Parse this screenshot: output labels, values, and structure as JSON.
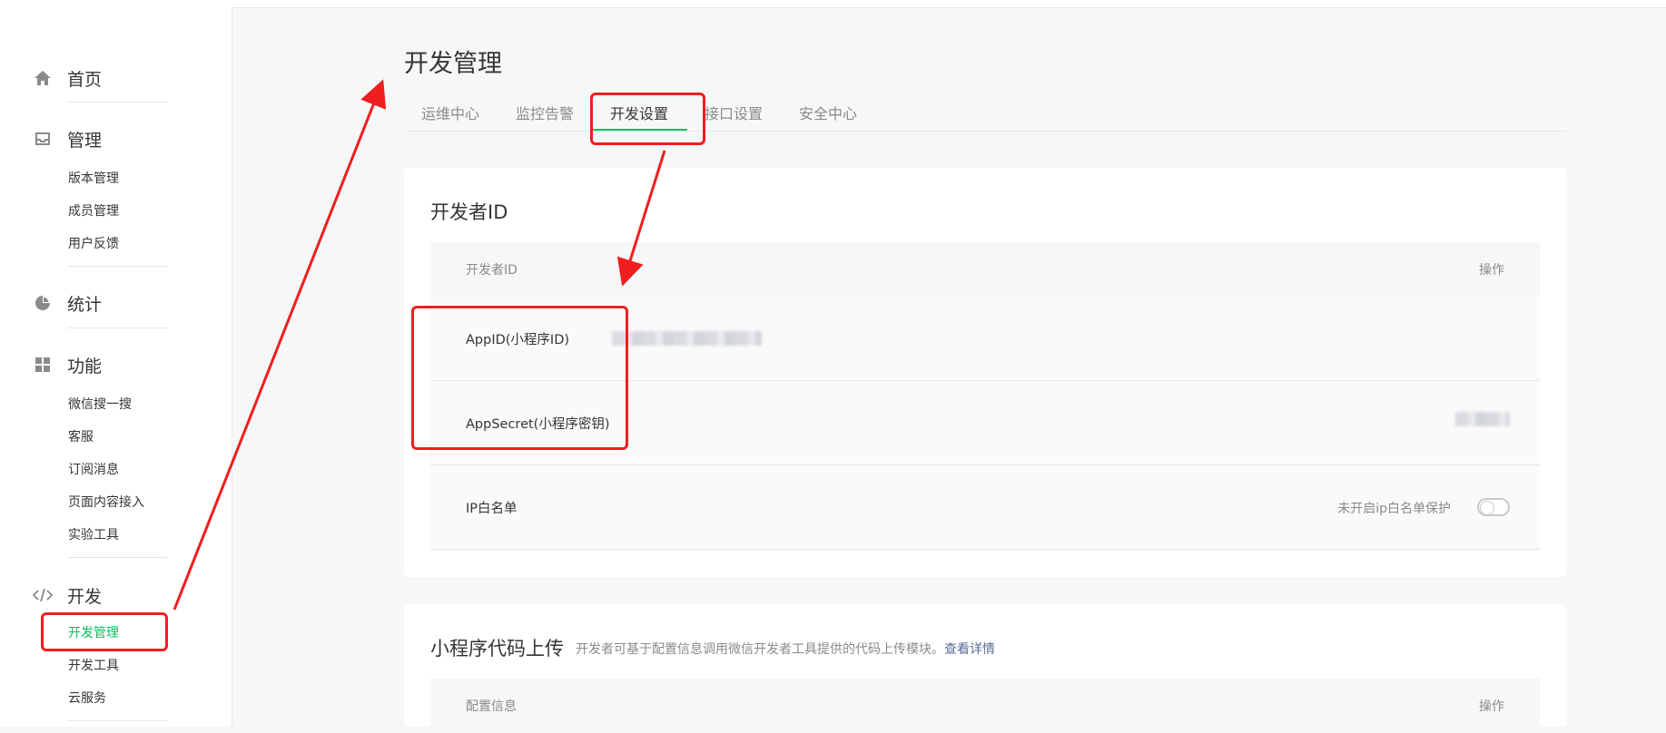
{
  "sidebar": {
    "groups": [
      {
        "label": "首页",
        "icon": "home-icon"
      },
      {
        "label": "管理",
        "icon": "inbox-icon",
        "items": [
          "版本管理",
          "成员管理",
          "用户反馈"
        ]
      },
      {
        "label": "统计",
        "icon": "pie-chart-icon"
      },
      {
        "label": "功能",
        "icon": "grid-icon",
        "items": [
          "微信搜一搜",
          "客服",
          "订阅消息",
          "页面内容接入",
          "实验工具"
        ]
      },
      {
        "label": "开发",
        "icon": "code-icon",
        "items": [
          "开发管理",
          "开发工具",
          "云服务"
        ]
      }
    ],
    "active_item": "开发管理"
  },
  "page_title": "开发管理",
  "tabs": [
    "运维中心",
    "监控告警",
    "开发设置",
    "接口设置",
    "安全中心"
  ],
  "active_tab": "开发设置",
  "developer_id": {
    "title": "开发者ID",
    "col_left": "开发者ID",
    "col_right": "操作",
    "rows": [
      {
        "label": "AppID(小程序ID)"
      },
      {
        "label": "AppSecret(小程序密钥)"
      },
      {
        "label": "IP白名单",
        "toggle_label": "未开启ip白名单保护",
        "toggle_on": false
      }
    ]
  },
  "upload": {
    "title": "小程序代码上传",
    "note": "开发者可基于配置信息调用微信开发者工具提供的代码上传模块。",
    "link": "查看详情",
    "col_left": "配置信息",
    "col_right": "操作"
  },
  "colors": {
    "accent": "#07c160",
    "annotation": "#f01e1e",
    "link": "#576b95"
  }
}
